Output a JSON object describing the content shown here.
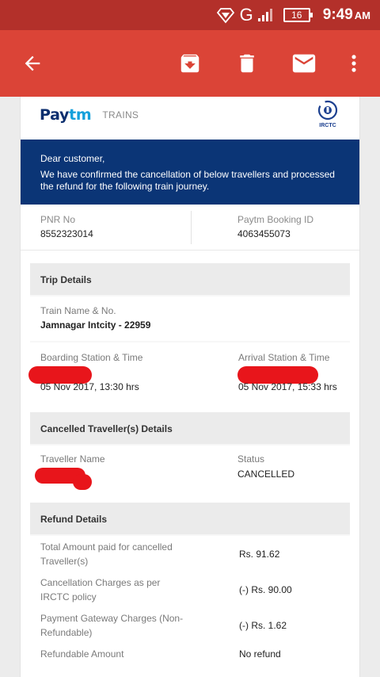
{
  "status_bar": {
    "network": "G",
    "battery": "16",
    "time": "9:49",
    "ampm": "AM"
  },
  "app_bar": {
    "icons": [
      "back-arrow-icon",
      "archive-icon",
      "delete-icon",
      "mail-icon",
      "more-vert-icon"
    ]
  },
  "email": {
    "brand": {
      "logo_pay": "Pay",
      "logo_tm": "tm",
      "section": "TRAINS",
      "partner_text": "IRCTC"
    },
    "banner": {
      "greeting": "Dear customer,",
      "message": "We have confirmed the cancellation of below travellers and processed the refund for the following train journey."
    },
    "pnr": {
      "label": "PNR No",
      "value": "8552323014"
    },
    "booking": {
      "label": "Paytm Booking ID",
      "value": "4063455073"
    },
    "trip": {
      "title": "Trip Details",
      "train_label": "Train Name & No.",
      "train_value": "Jamnagar Intcity - 22959",
      "boarding_label": "Boarding Station & Time",
      "boarding_time": "05 Nov 2017, 13:30 hrs",
      "arrival_label": "Arrival Station & Time",
      "arrival_time": "05 Nov 2017, 15:33 hrs"
    },
    "travellers": {
      "title": "Cancelled Traveller(s) Details",
      "name_label": "Traveller Name",
      "status_label": "Status",
      "status_value": "CANCELLED"
    },
    "refund": {
      "title": "Refund Details",
      "rows": [
        {
          "label": "Total Amount paid for cancelled Traveller(s)",
          "value": "Rs. 91.62"
        },
        {
          "label": "Cancellation Charges as per IRCTC policy",
          "value": "(-) Rs. 90.00"
        },
        {
          "label": "Payment Gateway Charges (Non-Refundable)",
          "value": "(-) Rs. 1.62"
        },
        {
          "label": "Refundable Amount",
          "value": "No refund"
        }
      ]
    }
  },
  "colors": {
    "status_bar": "#b3302a",
    "app_bar": "#db4437",
    "banner": "#0b3576",
    "redaction": "#e8151b"
  }
}
